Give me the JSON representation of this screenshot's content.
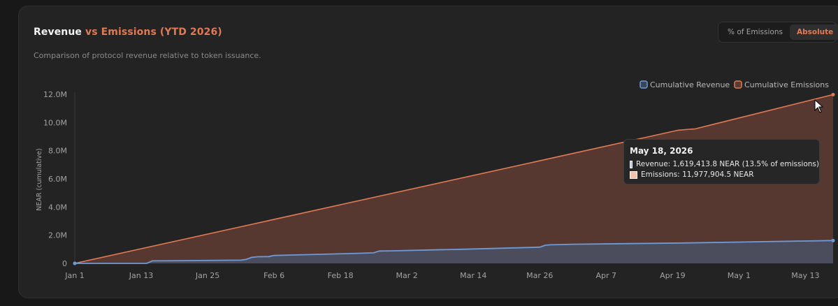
{
  "header": {
    "title_main": "Revenue",
    "title_accent": "vs Emissions (YTD 2026)",
    "subtitle": "Comparison of protocol revenue relative to token issuance."
  },
  "toggle": {
    "options": [
      "% of Emissions",
      "Absolute"
    ],
    "active": "Absolute"
  },
  "colors": {
    "revenue": "#6e9ad9",
    "emissions": "#e07a55",
    "emissions_fill": "#5b3a31",
    "revenue_fill": "#4a4f62",
    "title_accent": "#e07a55"
  },
  "tooltip": {
    "date": "May 18, 2026",
    "revenue_line": "Revenue: 1,619,413.8 NEAR (13.5% of emissions)",
    "emissions_line": "Emissions: 11,977,904.5 NEAR"
  },
  "chart_data": {
    "type": "area",
    "title": "Revenue vs Emissions (YTD 2026)",
    "ylabel": "NEAR (cumulative)",
    "ylim": [
      0,
      12000000
    ],
    "yticks": [
      0,
      2000000,
      4000000,
      6000000,
      8000000,
      10000000,
      12000000
    ],
    "ytick_labels": [
      "0",
      "2.0M",
      "4.0M",
      "6.0M",
      "8.0M",
      "10.0M",
      "12.0M"
    ],
    "xlim": [
      0,
      137
    ],
    "xticks": [
      0,
      12,
      24,
      36,
      48,
      60,
      72,
      84,
      96,
      108,
      120,
      132
    ],
    "xtick_labels": [
      "Jan 1",
      "Jan 13",
      "Jan 25",
      "Feb 6",
      "Feb 18",
      "Mar 2",
      "Mar 14",
      "Mar 26",
      "Apr 7",
      "Apr 19",
      "May 1",
      "May 13"
    ],
    "legend_position": "top-right",
    "grid": false,
    "series": [
      {
        "name": "Cumulative Revenue",
        "x": [
          0,
          13,
          14,
          30,
          31,
          32,
          33,
          35,
          36,
          40,
          50,
          54,
          55,
          57,
          64,
          70,
          84,
          85,
          86,
          90,
          110,
          120,
          137
        ],
        "values": [
          0,
          0,
          180000,
          230000,
          290000,
          430000,
          470000,
          480000,
          560000,
          600000,
          700000,
          750000,
          880000,
          890000,
          950000,
          1000000,
          1150000,
          1290000,
          1320000,
          1360000,
          1450000,
          1510000,
          1619413.8
        ]
      },
      {
        "name": "Cumulative Emissions",
        "x": [
          0,
          109,
          111,
          112,
          137
        ],
        "values": [
          0,
          9450000,
          9520000,
          9540000,
          11977904.5
        ]
      }
    ]
  }
}
